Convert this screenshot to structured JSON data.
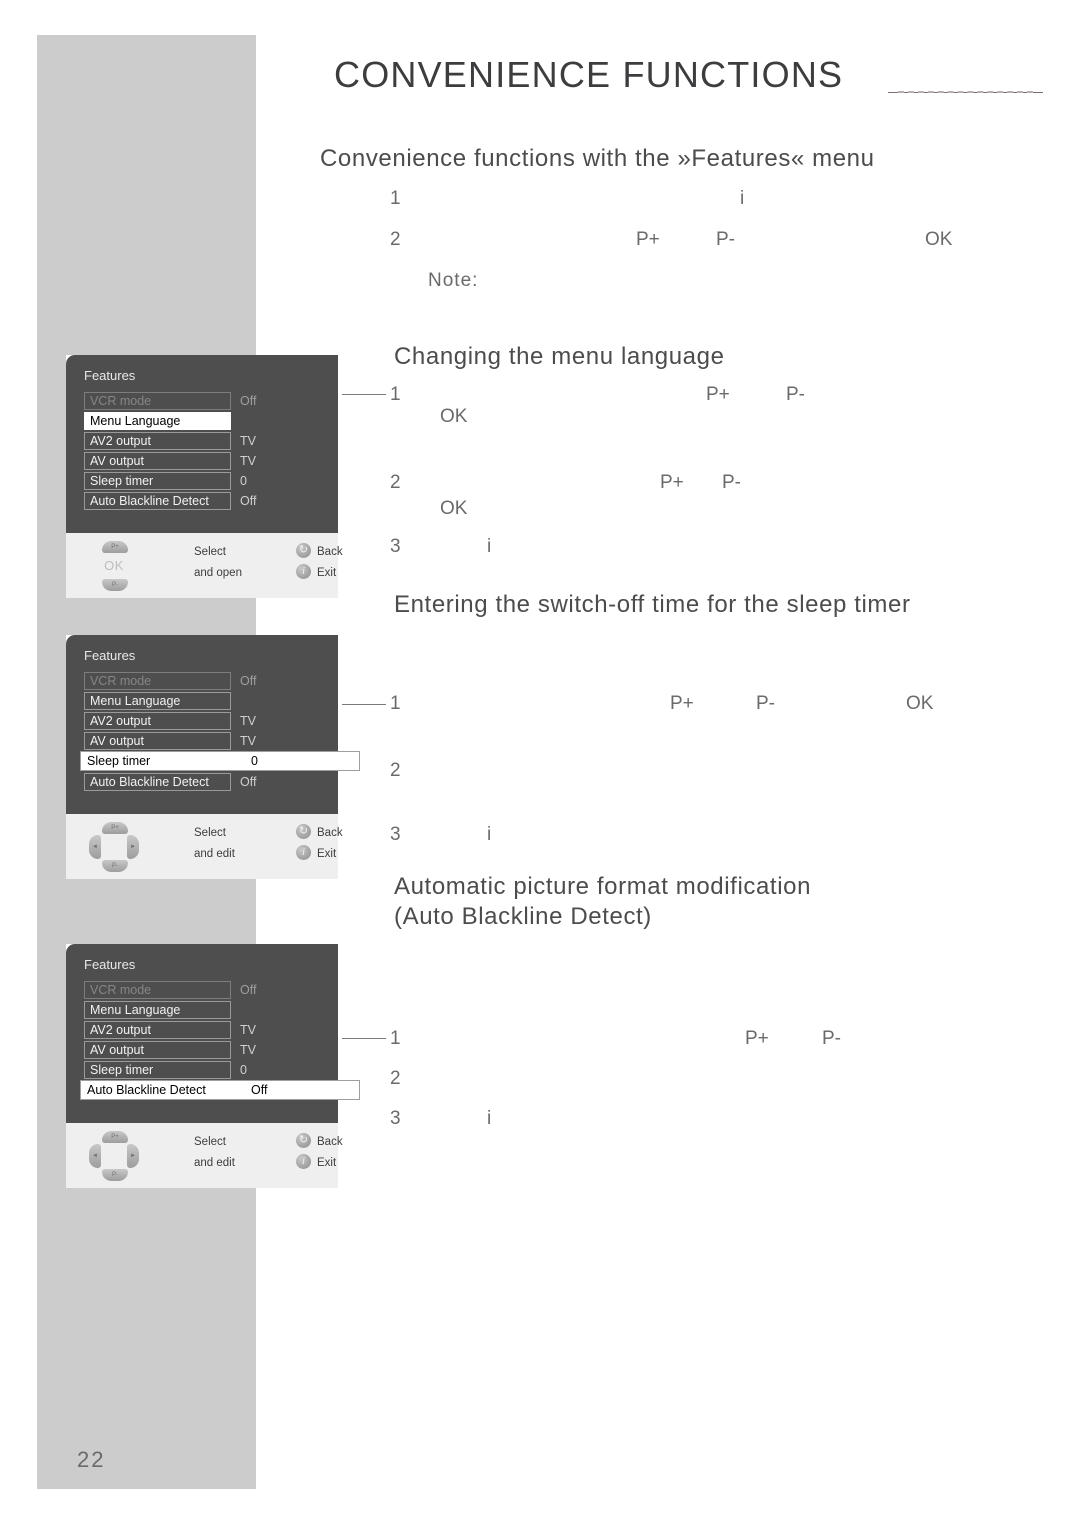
{
  "page": {
    "number": "22",
    "chapter_title": "CONVENIENCE FUNCTIONS"
  },
  "sections": [
    {
      "id": "features-menu",
      "heading": "Convenience functions with the »Features« menu",
      "steps": [
        {
          "num": "1",
          "keys": [
            "i"
          ]
        },
        {
          "num": "2",
          "keys": [
            "P+",
            "P-",
            "OK"
          ]
        }
      ],
      "note_label": "Note:"
    },
    {
      "id": "menu-language",
      "heading": "Changing the menu language",
      "steps": [
        {
          "num": "1",
          "keys": [
            "P+",
            "P-",
            "OK"
          ]
        },
        {
          "num": "2",
          "keys": [
            "P+",
            "P-",
            "OK"
          ]
        },
        {
          "num": "3",
          "keys": [
            "i"
          ]
        }
      ]
    },
    {
      "id": "sleep-timer",
      "heading": "Entering the switch-off time for the sleep timer",
      "steps": [
        {
          "num": "1",
          "keys": [
            "P+",
            "P-",
            "OK"
          ]
        },
        {
          "num": "2",
          "keys": []
        },
        {
          "num": "3",
          "keys": [
            "i"
          ]
        }
      ]
    },
    {
      "id": "blackline-detect",
      "heading_line1": "Automatic picture format modification",
      "heading_line2": "(Auto Blackline Detect)",
      "steps": [
        {
          "num": "1",
          "keys": [
            "P+",
            "P-"
          ]
        },
        {
          "num": "2",
          "keys": []
        },
        {
          "num": "3",
          "keys": [
            "i"
          ]
        }
      ]
    }
  ],
  "osd_screens": [
    {
      "id": "osd-menu-language",
      "title": "Features",
      "rows": [
        {
          "label": "VCR mode",
          "value": "Off",
          "state": "dim"
        },
        {
          "label": "Menu Language",
          "value": "",
          "state": "selected-label"
        },
        {
          "label": "AV2 output",
          "value": "TV",
          "state": "normal"
        },
        {
          "label": "AV output",
          "value": "TV",
          "state": "normal"
        },
        {
          "label": "Sleep timer",
          "value": "0",
          "state": "normal"
        },
        {
          "label": "Auto Blackline Detect",
          "value": "Off",
          "state": "normal"
        }
      ],
      "footer": {
        "pad_type": "updown",
        "pad_up": "P+",
        "pad_down": "P-",
        "pad_center": "OK",
        "action_primary": "Select",
        "action_secondary": "and open",
        "back_label": "Back",
        "exit_label": "Exit",
        "back_icon": "return-arrow-icon",
        "exit_icon": "info-icon"
      }
    },
    {
      "id": "osd-sleep-timer",
      "title": "Features",
      "rows": [
        {
          "label": "VCR mode",
          "value": "Off",
          "state": "dim"
        },
        {
          "label": "Menu Language",
          "value": "",
          "state": "normal"
        },
        {
          "label": "AV2 output",
          "value": "TV",
          "state": "normal"
        },
        {
          "label": "AV output",
          "value": "TV",
          "state": "normal"
        },
        {
          "label": "Sleep timer",
          "value": "0",
          "state": "selected-wide"
        },
        {
          "label": "Auto Blackline Detect",
          "value": "Off",
          "state": "normal"
        }
      ],
      "footer": {
        "pad_type": "fourway",
        "pad_up": "P+",
        "pad_down": "P-",
        "pad_left": "◄",
        "pad_right": "►",
        "pad_center": "",
        "action_primary": "Select",
        "action_secondary": "and edit",
        "back_label": "Back",
        "exit_label": "Exit",
        "back_icon": "return-arrow-icon",
        "exit_icon": "info-icon"
      }
    },
    {
      "id": "osd-blackline-detect",
      "title": "Features",
      "rows": [
        {
          "label": "VCR mode",
          "value": "Off",
          "state": "dim"
        },
        {
          "label": "Menu Language",
          "value": "",
          "state": "normal"
        },
        {
          "label": "AV2 output",
          "value": "TV",
          "state": "normal"
        },
        {
          "label": "AV output",
          "value": "TV",
          "state": "normal"
        },
        {
          "label": "Sleep timer",
          "value": "0",
          "state": "normal"
        },
        {
          "label": "Auto Blackline Detect",
          "value": "Off",
          "state": "selected-wide"
        }
      ],
      "footer": {
        "pad_type": "fourway",
        "pad_up": "P+",
        "pad_down": "P-",
        "pad_left": "◄",
        "pad_right": "►",
        "pad_center": "",
        "action_primary": "Select",
        "action_secondary": "and edit",
        "back_label": "Back",
        "exit_label": "Exit",
        "back_icon": "return-arrow-icon",
        "exit_icon": "info-icon"
      }
    }
  ],
  "colors": {
    "margin_gray": "#cccccc",
    "osd_background": "#4e4e4e",
    "osd_footer": "#efefef",
    "text": "#58585a",
    "selected_row": "#ffffff"
  }
}
